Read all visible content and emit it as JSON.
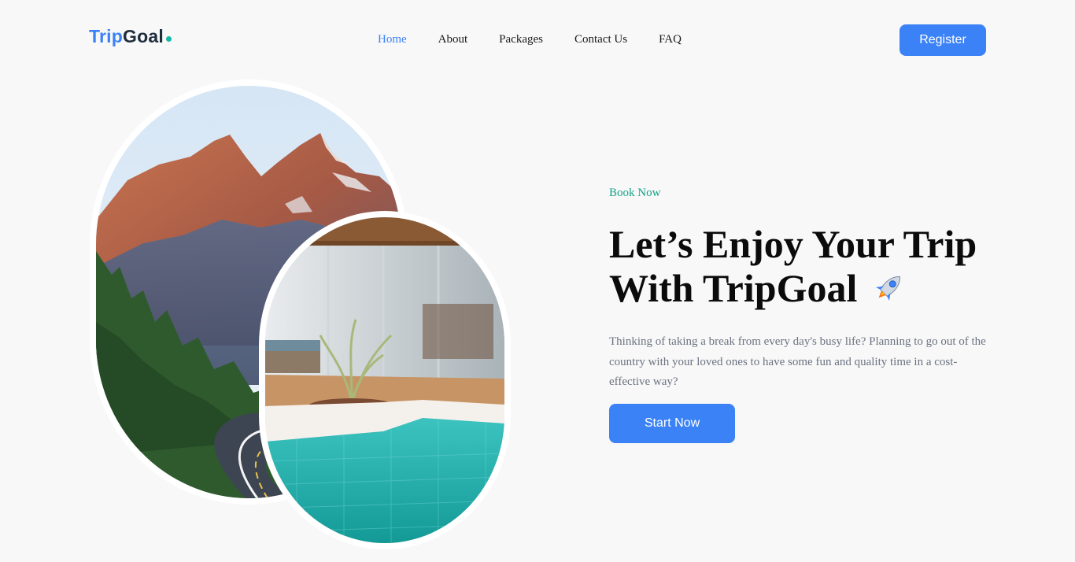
{
  "brand": {
    "name_part1": "Trip",
    "name_part2": "Goal",
    "accent_color": "#3b82f6",
    "dot_color": "#14b8a6"
  },
  "nav": {
    "items": [
      {
        "label": "Home",
        "active": true
      },
      {
        "label": "About",
        "active": false
      },
      {
        "label": "Packages",
        "active": false
      },
      {
        "label": "Contact Us",
        "active": false
      },
      {
        "label": "FAQ",
        "active": false
      }
    ]
  },
  "header": {
    "register_label": "Register"
  },
  "hero": {
    "kicker": "Book Now",
    "headline_line1": "Let’s Enjoy Your Trip",
    "headline_line2": "With TripGoal",
    "headline_icon": "rocket-icon",
    "description": "Thinking of taking a break from every day's busy life? Planning to go out of the country with your loved ones to have some fun and quality time in a cost-effective way?",
    "cta_label": "Start Now",
    "kicker_color": "#14a38b",
    "button_color": "#3b82f6"
  },
  "images": [
    {
      "name": "mountain-road-image",
      "subject": "mountain-photo"
    },
    {
      "name": "pool-villa-image",
      "subject": "pool-photo"
    }
  ]
}
